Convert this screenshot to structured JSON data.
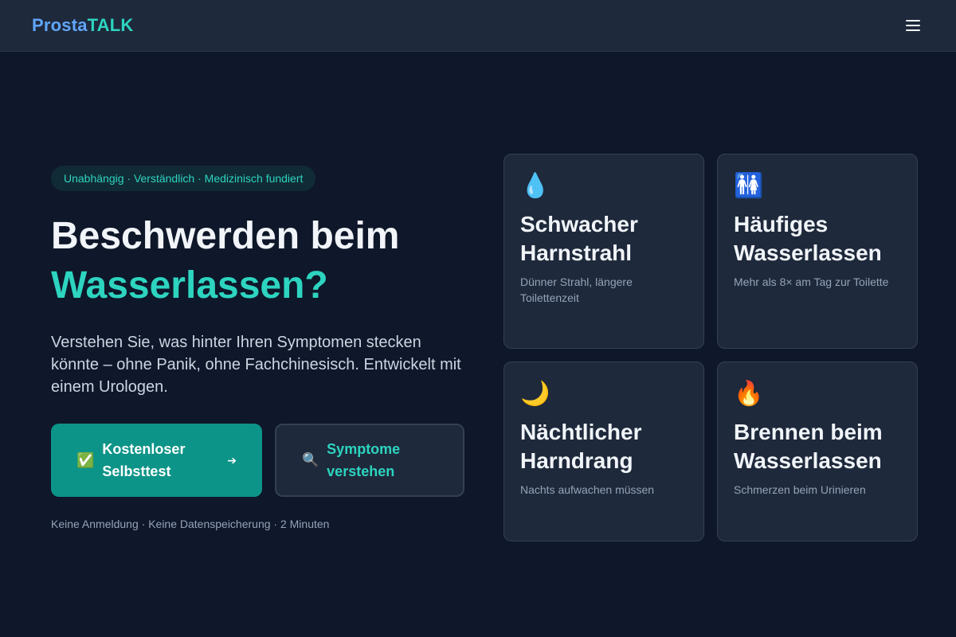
{
  "nav": {
    "logo_part1": "Prosta",
    "logo_part2": "TALK",
    "menu_icon": "hamburger-menu-icon"
  },
  "hero": {
    "badge": "Unabhängig · Verständlich · Medizinisch fundiert",
    "headline_line1": "Beschwerden beim",
    "headline_line2": "Wasserlassen?",
    "subtext": "Verstehen Sie, was hinter Ihren Symptomen stecken könnte – ohne Panik, ohne Fachchinesisch. Entwickelt mit einem Urologen.",
    "primary_button": {
      "icon": "✅",
      "label": "Kostenloser Selbsttest",
      "arrow": "➔"
    },
    "secondary_button": {
      "icon": "🔍",
      "label": "Symptome verstehen"
    },
    "footnote": "Keine Anmeldung · Keine Datenspeicherung · 2 Minuten"
  },
  "cards": [
    {
      "icon": "💧",
      "icon_name": "water-drop-icon",
      "title": "Schwacher Harnstrahl",
      "desc": "Dünner Strahl, längere Toilettenzeit"
    },
    {
      "icon": "🚻",
      "icon_name": "restroom-icon",
      "title": "Häufiges Wasserlassen",
      "desc": "Mehr als 8× am Tag zur Toilette"
    },
    {
      "icon": "🌙",
      "icon_name": "moon-icon",
      "title": "Nächtlicher Harndrang",
      "desc": "Nachts aufwachen müssen"
    },
    {
      "icon": "🔥",
      "icon_name": "fire-icon",
      "title": "Brennen beim Wasserlassen",
      "desc": "Schmerzen beim Urinieren"
    }
  ],
  "colors": {
    "background": "#0f172a",
    "navbar": "#1e293b",
    "accent": "#2dd4bf",
    "logo_blue": "#60a5fa",
    "primary_button": "#0d9488",
    "card": "#1e293b"
  }
}
